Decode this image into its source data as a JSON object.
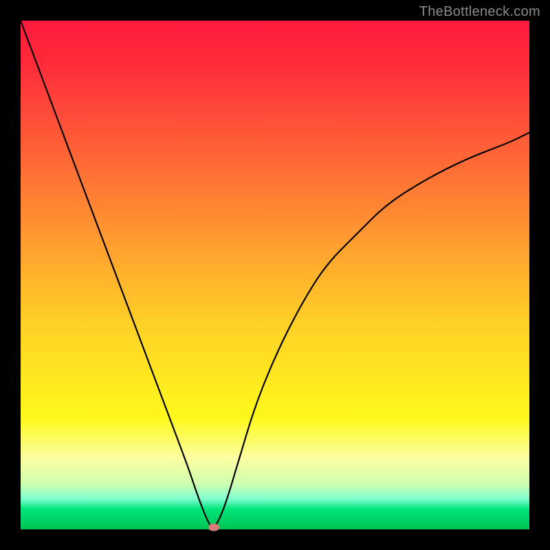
{
  "watermark": "TheBottleneck.com",
  "colors": {
    "frame": "#000000",
    "curve": "#000000",
    "marker": "#d87a7a",
    "gradient_top": "#ff1a3c",
    "gradient_mid": "#ffe820",
    "gradient_bottom": "#00c454"
  },
  "chart_data": {
    "type": "line",
    "title": "",
    "xlabel": "",
    "ylabel": "",
    "xlim": [
      0,
      100
    ],
    "ylim": [
      0,
      100
    ],
    "grid": false,
    "legend": false,
    "x": [
      0,
      3,
      6,
      9,
      12,
      15,
      18,
      21,
      24,
      27,
      30,
      33,
      35,
      37,
      38,
      40,
      43,
      46,
      50,
      55,
      60,
      66,
      72,
      80,
      88,
      96,
      100
    ],
    "y": [
      100,
      92,
      84,
      76,
      68,
      60,
      52,
      44,
      36,
      28,
      20,
      12,
      6,
      1,
      0,
      4,
      14,
      24,
      34,
      44,
      52,
      58,
      64,
      69,
      73,
      76,
      78
    ],
    "marker_point": {
      "x": 38,
      "y": 0
    },
    "annotations": []
  }
}
